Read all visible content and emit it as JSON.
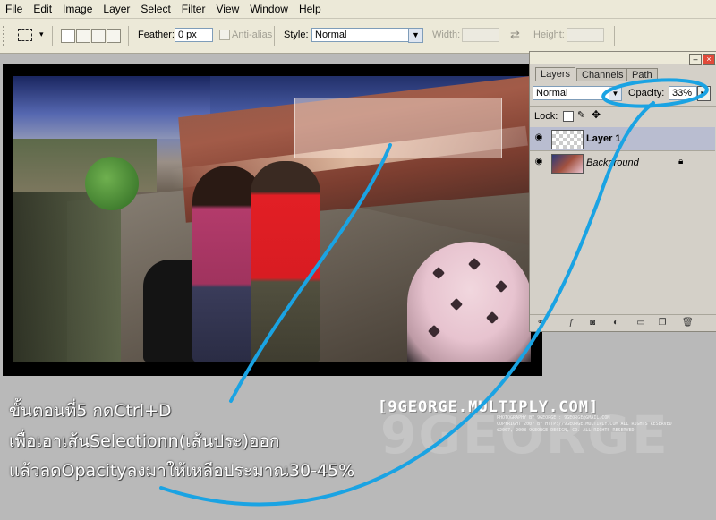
{
  "menu": [
    "File",
    "Edit",
    "Image",
    "Layer",
    "Select",
    "Filter",
    "View",
    "Window",
    "Help"
  ],
  "options": {
    "feather_label": "Feather:",
    "feather_value": "0 px",
    "antialias_label": "Anti-alias",
    "style_label": "Style:",
    "style_value": "Normal",
    "width_label": "Width:",
    "height_label": "Height:"
  },
  "layers_panel": {
    "tabs": [
      "Layers",
      "Channels",
      "Path"
    ],
    "blend_mode": "Normal",
    "opacity_label": "Opacity:",
    "opacity_value": "33%",
    "lock_label": "Lock:",
    "layers": [
      {
        "name": "Layer 1"
      },
      {
        "name": "Background"
      }
    ]
  },
  "caption": {
    "line1": "ขั้นตอนที่5  กดCtrl+D",
    "line2": "เพื่อเอาเส้นSelectionn(เส้นประ)ออก",
    "line3": "แล้วลดOpacityลงมาให้เหลือประมาณ30-45%"
  },
  "watermark": {
    "title": "[9GEORGE.MULTIPLY.COM]",
    "line1": "PHOTOGRAPHY BY 9GEORGE : 9GEORGE@GMAIL.COM",
    "line2": "COPYRIGHT 2007 BY HTTP://9GEORGE.MULTIPLY.COM ALL RIGHTS RESERVED",
    "line3": "©2007, 2008 9GEORGE DESIGN, CO. ALL RIGHTS RESERVED",
    "big": "9GEORGE"
  },
  "colors": {
    "annotation": "#1aa3e3",
    "caption_text": "#ffffff"
  }
}
